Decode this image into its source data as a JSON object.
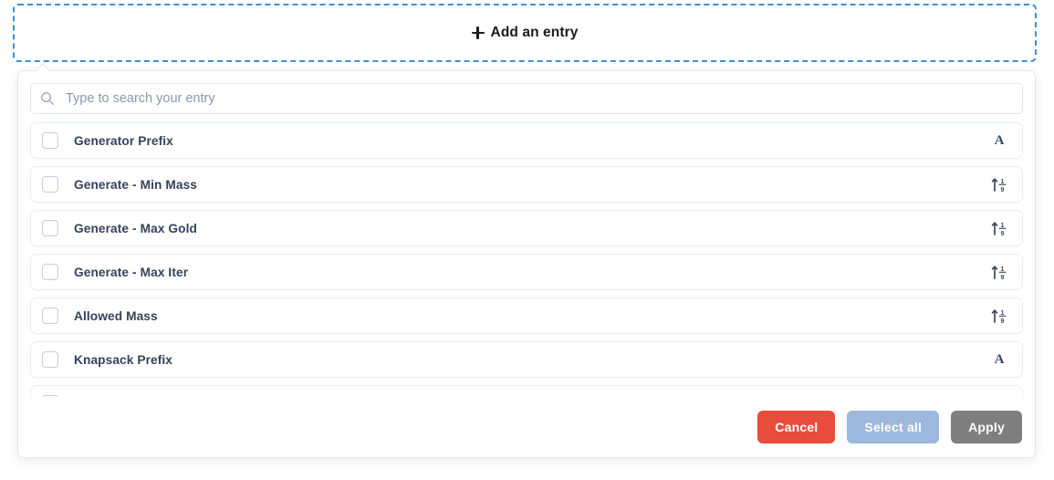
{
  "add_entry": {
    "label": "Add an entry",
    "icon": "plus-icon",
    "border_color": "#3f8fd2"
  },
  "search": {
    "placeholder": "Type to search your entry",
    "value": "",
    "icon": "search-icon"
  },
  "entries": [
    {
      "label": "Generator Prefix",
      "type_icon": "text-type-icon",
      "glyph": "A",
      "checked": false
    },
    {
      "label": "Generate - Min Mass",
      "type_icon": "number-type-icon",
      "glyph": "",
      "checked": false
    },
    {
      "label": "Generate - Max Gold",
      "type_icon": "number-type-icon",
      "glyph": "",
      "checked": false
    },
    {
      "label": "Generate - Max Iter",
      "type_icon": "number-type-icon",
      "glyph": "",
      "checked": false
    },
    {
      "label": "Allowed Mass",
      "type_icon": "number-type-icon",
      "glyph": "",
      "checked": false
    },
    {
      "label": "Knapsack Prefix",
      "type_icon": "text-type-icon",
      "glyph": "A",
      "checked": false
    },
    {
      "label": "",
      "type_icon": "",
      "glyph": "",
      "checked": false
    }
  ],
  "footer": {
    "cancel_label": "Cancel",
    "select_all_label": "Select all",
    "apply_label": "Apply",
    "cancel_color": "#e74c3c",
    "select_all_color": "#9cb8dc",
    "apply_color": "#7f7f7f"
  }
}
